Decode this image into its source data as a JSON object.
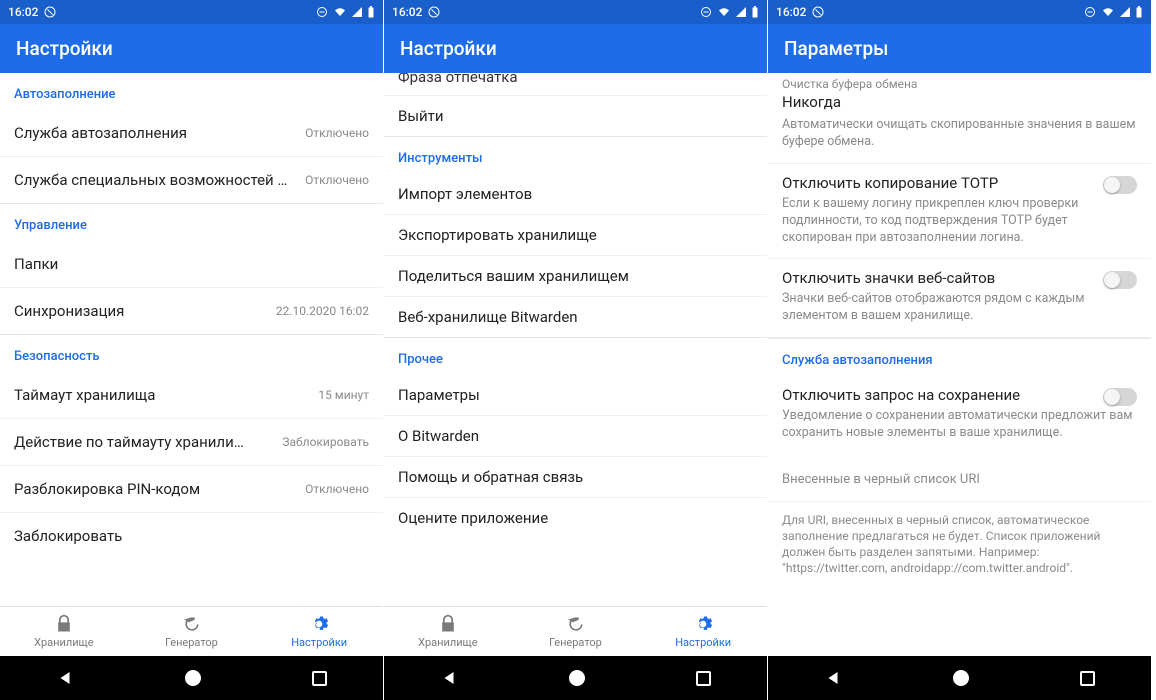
{
  "status": {
    "time": "16:02"
  },
  "screen1": {
    "title": "Настройки",
    "sections": {
      "autofill": {
        "header": "Автозаполнение",
        "items": [
          {
            "title": "Служба автозаполнения",
            "value": "Отключено"
          },
          {
            "title": "Служба специальных возможностей …",
            "value": "Отключено"
          }
        ]
      },
      "manage": {
        "header": "Управление",
        "items": [
          {
            "title": "Папки",
            "value": ""
          },
          {
            "title": "Синхронизация",
            "value": "22.10.2020 16:02"
          }
        ]
      },
      "security": {
        "header": "Безопасность",
        "items": [
          {
            "title": "Таймаут хранилища",
            "value": "15 минут"
          },
          {
            "title": "Действие по таймауту хранили…",
            "value": "Заблокировать"
          },
          {
            "title": "Разблокировка PIN-кодом",
            "value": "Отключено"
          },
          {
            "title": "Заблокировать",
            "value": ""
          }
        ]
      }
    },
    "tabs": {
      "vault": "Хранилище",
      "generator": "Генератор",
      "settings": "Настройки"
    }
  },
  "screen2": {
    "title": "Настройки",
    "cutoff": "Фраза отпечатка",
    "top_items": [
      {
        "title": "Выйти"
      }
    ],
    "tools": {
      "header": "Инструменты",
      "items": [
        {
          "title": "Импорт элементов"
        },
        {
          "title": "Экспортировать хранилище"
        },
        {
          "title": "Поделиться вашим хранилищем"
        },
        {
          "title": "Веб-хранилище Bitwarden"
        }
      ]
    },
    "other": {
      "header": "Прочее",
      "items": [
        {
          "title": "Параметры"
        },
        {
          "title": "О Bitwarden"
        },
        {
          "title": "Помощь и обратная связь"
        },
        {
          "title": "Оцените приложение"
        }
      ]
    },
    "tabs": {
      "vault": "Хранилище",
      "generator": "Генератор",
      "settings": "Настройки"
    }
  },
  "screen3": {
    "title": "Параметры",
    "clipboard": {
      "label": "Очистка буфера обмена",
      "value": "Никогда",
      "desc": "Автоматически очищать скопированные значения в вашем буфере обмена."
    },
    "totp": {
      "title": "Отключить копирование TOTP",
      "desc": "Если к вашему логину прикреплен ключ проверки подлинности, то код подтверждения TOTP будет скопирован при автозаполнении логина."
    },
    "icons": {
      "title": "Отключить значки веб-сайтов",
      "desc": "Значки веб-сайтов отображаются рядом с каждым элементом в вашем хранилище."
    },
    "autofill_section": {
      "header": "Служба автозаполнения",
      "save_prompt": {
        "title": "Отключить запрос на сохранение",
        "desc": "Уведомление о сохранении автоматически предложит вам сохранить новые элементы в ваше хранилище."
      },
      "blacklist": {
        "title": "Внесенные в черный список URI"
      },
      "footer": "Для URI, внесенных в черный список, автоматическое заполнение предлагаться не будет. Список приложений должен быть разделен запятыми. Например: \"https://twitter.com, androidapp://com.twitter.android\"."
    }
  }
}
